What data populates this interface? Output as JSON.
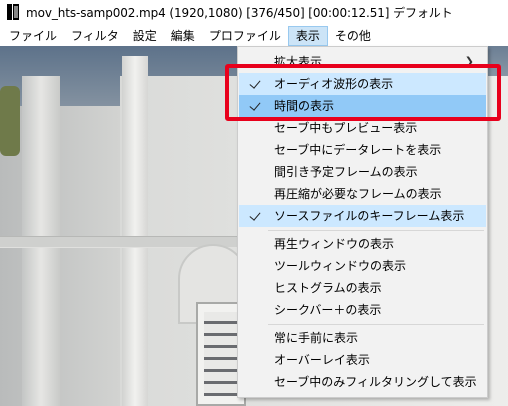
{
  "title_bar": {
    "text": "mov_hts-samp002.mp4 (1920,1080)  [376/450] [00:00:12.51]  デフォルト"
  },
  "menubar": {
    "items": [
      {
        "label": "ファイル"
      },
      {
        "label": "フィルタ"
      },
      {
        "label": "設定"
      },
      {
        "label": "編集"
      },
      {
        "label": "プロファイル"
      },
      {
        "label": "表示"
      },
      {
        "label": "その他"
      }
    ]
  },
  "view_menu": {
    "items": [
      {
        "label": "拡大表示",
        "checked": false,
        "submenu": true
      },
      {
        "label": "オーディオ波形の表示",
        "checked": true
      },
      {
        "label": "時間の表示",
        "checked": true
      },
      {
        "label": "セーブ中もプレビュー表示",
        "checked": false
      },
      {
        "label": "セーブ中にデータレートを表示",
        "checked": false
      },
      {
        "label": "間引き予定フレームの表示",
        "checked": false
      },
      {
        "label": "再圧縮が必要なフレームの表示",
        "checked": false
      },
      {
        "label": "ソースファイルのキーフレーム表示",
        "checked": true
      },
      {
        "label": "再生ウィンドウの表示",
        "checked": false
      },
      {
        "label": "ツールウィンドウの表示",
        "checked": false
      },
      {
        "label": "ヒストグラムの表示",
        "checked": false
      },
      {
        "label": "シークバー＋の表示",
        "checked": false
      },
      {
        "label": "常に手前に表示",
        "checked": false
      },
      {
        "label": "オーバーレイ表示",
        "checked": false
      },
      {
        "label": "セーブ中のみフィルタリングして表示",
        "checked": false
      }
    ]
  },
  "colors": {
    "menu_bg": "#f2f2f2",
    "hover_highlight": "#91c9f7",
    "check_highlight": "#cce8ff",
    "annotation_red": "#e8001c"
  }
}
